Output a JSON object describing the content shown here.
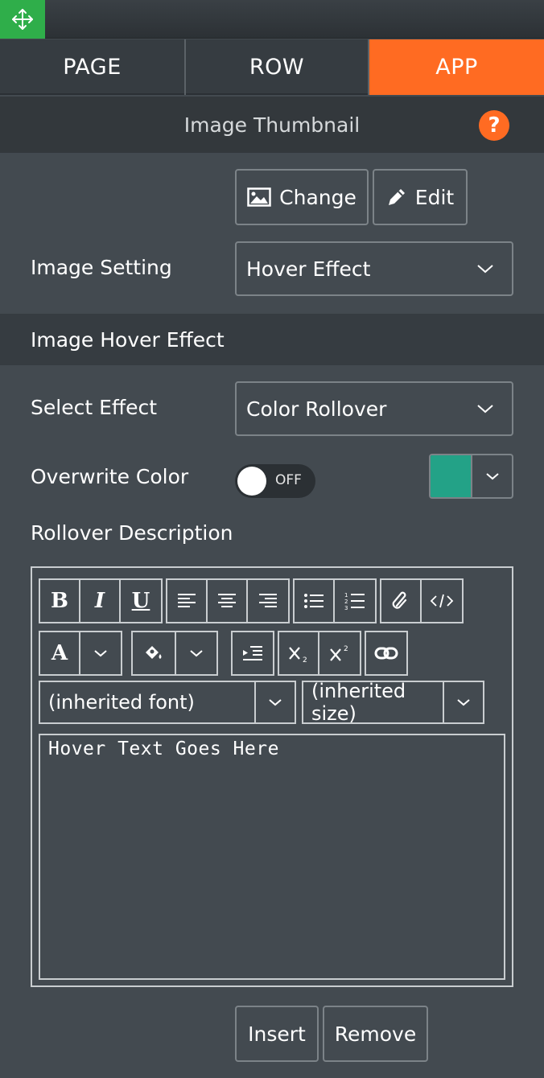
{
  "tabs": [
    {
      "label": "PAGE",
      "active": false
    },
    {
      "label": "ROW",
      "active": false
    },
    {
      "label": "APP",
      "active": true
    }
  ],
  "panel": {
    "title": "Image Thumbnail"
  },
  "image_buttons": {
    "change_label": "Change",
    "edit_label": "Edit"
  },
  "image_setting": {
    "label": "Image Setting",
    "value": "Hover Effect"
  },
  "hover_section": {
    "title": "Image Hover Effect"
  },
  "select_effect": {
    "label": "Select Effect",
    "value": "Color Rollover"
  },
  "overwrite_color": {
    "label": "Overwrite Color",
    "toggle_text": "OFF",
    "toggle_on": false,
    "swatch_color": "#23a287"
  },
  "rollover": {
    "label": "Rollover Description",
    "font_value": "(inherited font)",
    "size_value": "(inherited size)",
    "text": "Hover Text Goes Here"
  },
  "actions": {
    "insert_label": "Insert",
    "remove_label": "Remove"
  },
  "colors": {
    "accent": "#ff6b22",
    "move_handle": "#2fae4a",
    "background": "#434a50"
  }
}
